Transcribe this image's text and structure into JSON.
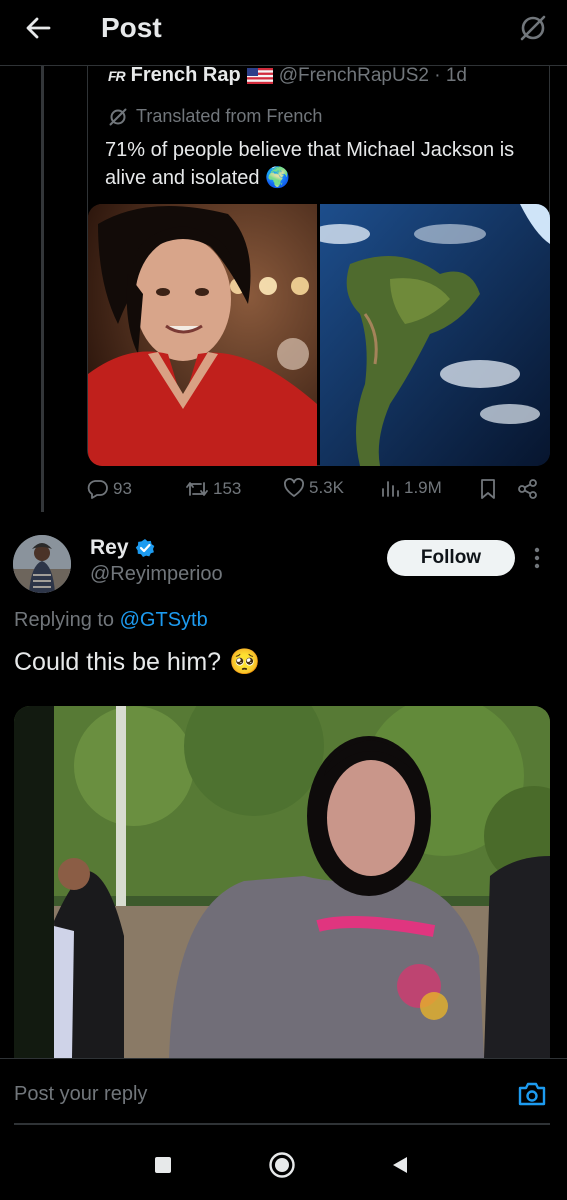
{
  "header": {
    "title": "Post"
  },
  "quote": {
    "logo_text": "FR",
    "name": "French Rap",
    "handle": "@FrenchRapUS2 · 1d",
    "translated": "Translated from French",
    "text": "71% of people believe that Michael Jackson is alive and isolated",
    "emoji": "🌍"
  },
  "actions": {
    "replies": "93",
    "reposts": "153",
    "likes": "5.3K",
    "views": "1.9M"
  },
  "reply": {
    "name": "Rey",
    "handle": "@Reyimperioo",
    "follow_label": "Follow",
    "replying_prefix": "Replying to",
    "replying_mention": "@GTSytb",
    "text": "Could this be him?",
    "emoji": "🥺"
  },
  "composer": {
    "placeholder": "Post your reply"
  },
  "colors": {
    "accent": "#1d9bf0",
    "background": "#000000",
    "secondary_text": "#71767b",
    "border": "#2f3336"
  },
  "icons": {
    "back": "arrow-left-icon",
    "grok": "grok-icon",
    "translate": "translate-icon",
    "reply": "reply-icon",
    "repost": "repost-icon",
    "like": "heart-icon",
    "views": "views-icon",
    "bookmark": "bookmark-icon",
    "share": "share-icon",
    "verified": "verified-badge-icon",
    "more": "more-icon",
    "camera": "camera-icon"
  }
}
